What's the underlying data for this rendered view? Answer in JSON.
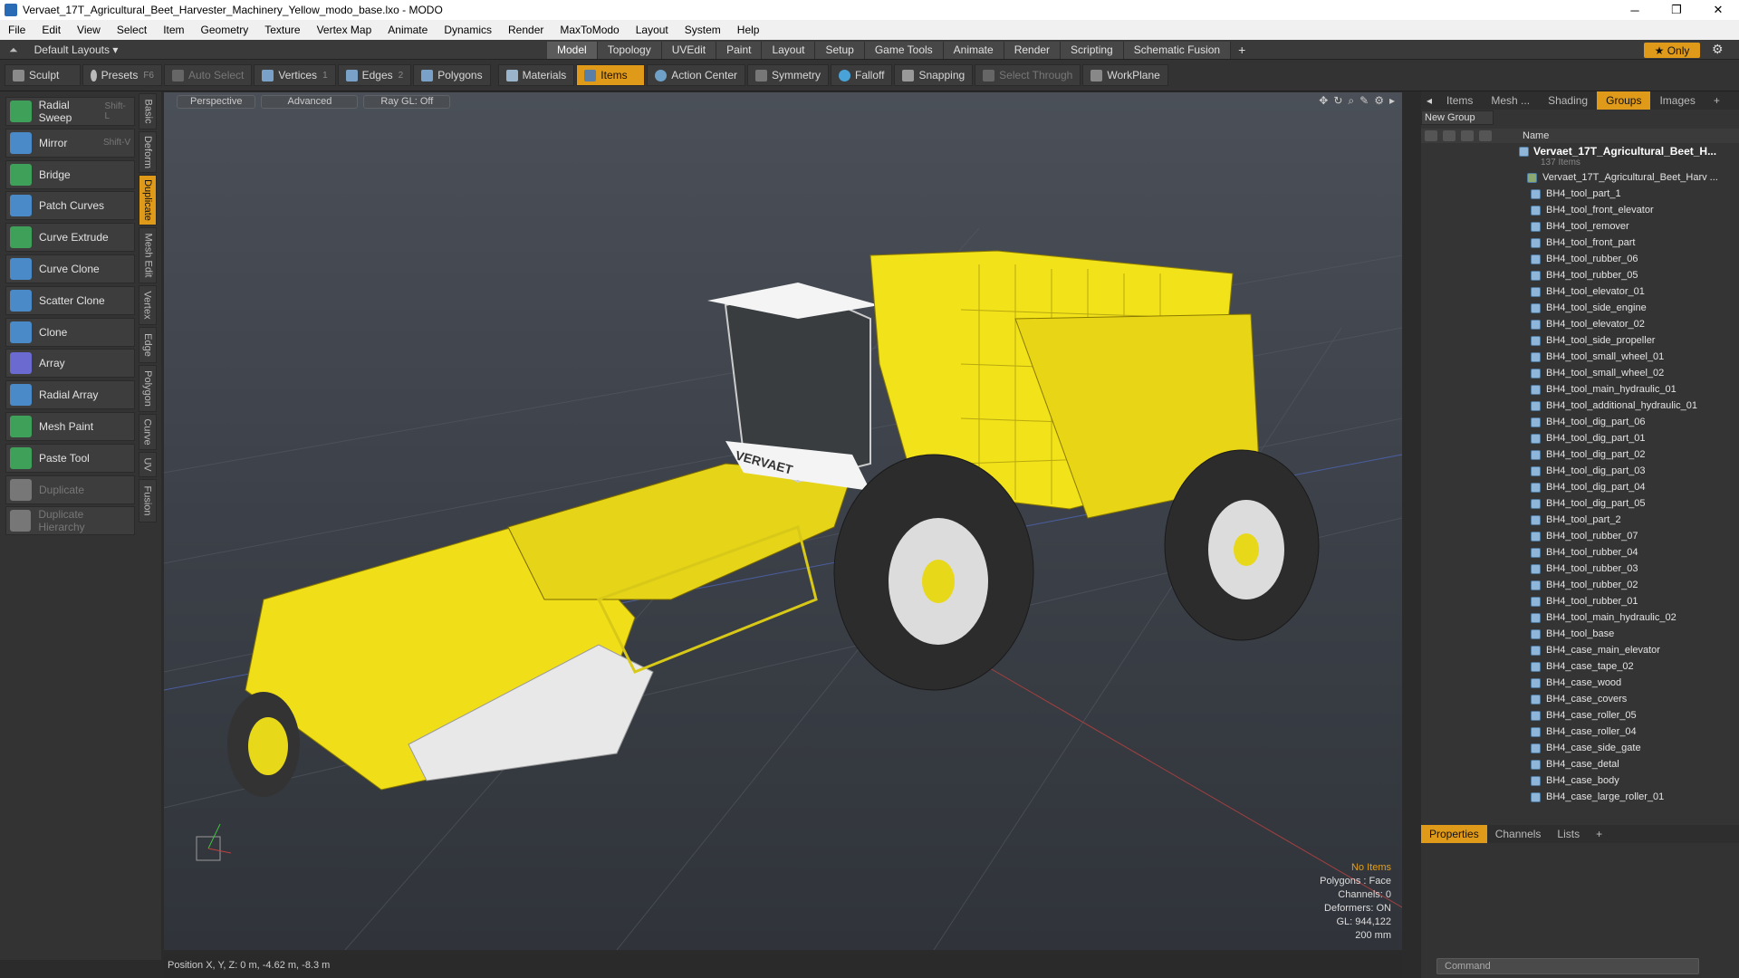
{
  "window": {
    "title": "Vervaet_17T_Agricultural_Beet_Harvester_Machinery_Yellow_modo_base.lxo - MODO",
    "minimize": "─",
    "maximize": "❐",
    "close": "✕"
  },
  "menu": [
    "File",
    "Edit",
    "View",
    "Select",
    "Item",
    "Geometry",
    "Texture",
    "Vertex Map",
    "Animate",
    "Dynamics",
    "Render",
    "MaxToModo",
    "Layout",
    "System",
    "Help"
  ],
  "layouts": {
    "label": "Default Layouts ▾"
  },
  "tabs": [
    "Model",
    "Topology",
    "UVEdit",
    "Paint",
    "Layout",
    "Setup",
    "Game Tools",
    "Animate",
    "Render",
    "Scripting",
    "Schematic Fusion"
  ],
  "active_tab": "Model",
  "tab_add": "+",
  "only_button": "★  Only",
  "toolbar": {
    "sculpt": "Sculpt",
    "presets": "Presets",
    "presets_key": "F6",
    "auto_select": "Auto Select",
    "vertices": "Vertices",
    "vertices_count": "1",
    "edges": "Edges",
    "edges_count": "2",
    "polygons": "Polygons",
    "materials": "Materials",
    "items": "Items",
    "action_center": "Action Center",
    "symmetry": "Symmetry",
    "falloff": "Falloff",
    "snapping": "Snapping",
    "select_through": "Select Through",
    "workplane": "WorkPlane"
  },
  "tools": [
    {
      "label": "Radial Sweep",
      "shortcut": "Shift-L",
      "icon": "radial-sweep-icon",
      "enabled": true
    },
    {
      "label": "Mirror",
      "shortcut": "Shift-V",
      "icon": "mirror-icon",
      "enabled": true
    },
    {
      "label": "Bridge",
      "shortcut": "",
      "icon": "bridge-icon",
      "enabled": true
    },
    {
      "label": "Patch Curves",
      "shortcut": "",
      "icon": "patch-curves-icon",
      "enabled": true
    },
    {
      "label": "Curve Extrude",
      "shortcut": "",
      "icon": "curve-extrude-icon",
      "enabled": true
    },
    {
      "label": "Curve Clone",
      "shortcut": "",
      "icon": "curve-clone-icon",
      "enabled": true
    },
    {
      "label": "Scatter Clone",
      "shortcut": "",
      "icon": "scatter-clone-icon",
      "enabled": true
    },
    {
      "label": "Clone",
      "shortcut": "",
      "icon": "clone-icon",
      "enabled": true
    },
    {
      "label": "Array",
      "shortcut": "",
      "icon": "array-icon",
      "enabled": true
    },
    {
      "label": "Radial Array",
      "shortcut": "",
      "icon": "radial-array-icon",
      "enabled": true
    },
    {
      "label": "Mesh Paint",
      "shortcut": "",
      "icon": "mesh-paint-icon",
      "enabled": true
    },
    {
      "label": "Paste Tool",
      "shortcut": "",
      "icon": "paste-tool-icon",
      "enabled": true
    },
    {
      "label": "Duplicate",
      "shortcut": "",
      "icon": "duplicate-icon",
      "enabled": false
    },
    {
      "label": "Duplicate Hierarchy",
      "shortcut": "",
      "icon": "duplicate-hierarchy-icon",
      "enabled": false
    }
  ],
  "side_tabs": [
    "Basic",
    "Deform",
    "Duplicate",
    "Mesh Edit",
    "Vertex",
    "Edge",
    "Polygon",
    "Curve",
    "UV",
    "Fusion"
  ],
  "active_side_tab": "Duplicate",
  "viewport": {
    "perspective": "Perspective",
    "advanced": "Advanced",
    "raygl": "Ray GL: Off",
    "hud": {
      "no_items": "No Items",
      "polygons": "Polygons : Face",
      "channels": "Channels: 0",
      "deformers": "Deformers: ON",
      "gl": "GL: 944,122",
      "scale": "200 mm"
    },
    "machine_label": "VERVAET"
  },
  "status": {
    "position": "Position X, Y, Z:  0 m, -4.62 m, -8.3 m"
  },
  "right_tabs": [
    "Items",
    "Mesh ...",
    "Shading",
    "Groups",
    "Images",
    "+"
  ],
  "active_right_tab": "Groups",
  "new_group": "New Group",
  "list_header": "Name",
  "group": {
    "name": "Vervaet_17T_Agricultural_Beet_H...",
    "count": "137 Items"
  },
  "items": [
    "Vervaet_17T_Agricultural_Beet_Harv ...",
    "BH4_tool_part_1",
    "BH4_tool_front_elevator",
    "BH4_tool_remover",
    "BH4_tool_front_part",
    "BH4_tool_rubber_06",
    "BH4_tool_rubber_05",
    "BH4_tool_elevator_01",
    "BH4_tool_side_engine",
    "BH4_tool_elevator_02",
    "BH4_tool_side_propeller",
    "BH4_tool_small_wheel_01",
    "BH4_tool_small_wheel_02",
    "BH4_tool_main_hydraulic_01",
    "BH4_tool_additional_hydraulic_01",
    "BH4_tool_dig_part_06",
    "BH4_tool_dig_part_01",
    "BH4_tool_dig_part_02",
    "BH4_tool_dig_part_03",
    "BH4_tool_dig_part_04",
    "BH4_tool_dig_part_05",
    "BH4_tool_part_2",
    "BH4_tool_rubber_07",
    "BH4_tool_rubber_04",
    "BH4_tool_rubber_03",
    "BH4_tool_rubber_02",
    "BH4_tool_rubber_01",
    "BH4_tool_main_hydraulic_02",
    "BH4_tool_base",
    "BH4_case_main_elevator",
    "BH4_case_tape_02",
    "BH4_case_wood",
    "BH4_case_covers",
    "BH4_case_roller_05",
    "BH4_case_roller_04",
    "BH4_case_side_gate",
    "BH4_case_detal",
    "BH4_case_body",
    "BH4_case_large_roller_01"
  ],
  "bottom_tabs": [
    "Properties",
    "Channels",
    "Lists",
    "+"
  ],
  "active_bottom_tab": "Properties",
  "command": {
    "placeholder": "Command"
  },
  "colors": {
    "accent": "#e09a1a",
    "machine_yellow": "#f2e21a",
    "viewport_bg": "#3c4048"
  }
}
